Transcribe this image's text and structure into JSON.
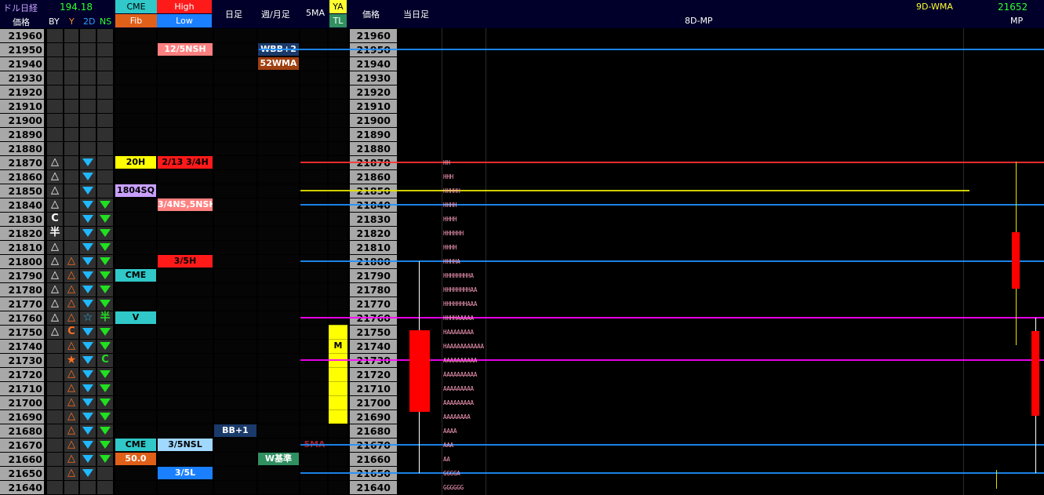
{
  "header": {
    "dollar_nikkei": "ドル日経",
    "dollar_value": "194.18",
    "price_label": "価格",
    "by": "BY",
    "y": "Y",
    "d2": "2D",
    "ns": "NS",
    "cme": "CME",
    "fib": "Fib",
    "high": "High",
    "low": "Low",
    "daily": "日足",
    "weekly_monthly": "週/月足",
    "ma5": "5MA",
    "ya": "YA",
    "tl": "TL",
    "price_label2": "価格",
    "today": "当日足",
    "mp8d": "8D-MP",
    "wma9d": "9D-WMA",
    "mp_value": "21652",
    "mp": "MP"
  },
  "prices": [
    "21960",
    "21950",
    "21940",
    "21930",
    "21920",
    "21910",
    "21900",
    "21890",
    "21880",
    "21870",
    "21860",
    "21850",
    "21840",
    "21830",
    "21820",
    "21810",
    "21800",
    "21790",
    "21780",
    "21770",
    "21760",
    "21750",
    "21740",
    "21730",
    "21720",
    "21710",
    "21700",
    "21690",
    "21680",
    "21670",
    "21660",
    "21650",
    "21640"
  ],
  "by_col": {
    "9": "△",
    "10": "△",
    "11": "△",
    "12": "△",
    "13": "C",
    "14": "半",
    "15": "△",
    "16": "△",
    "17": "△",
    "18": "△",
    "19": "△",
    "20": "△",
    "21": "△"
  },
  "y_col": {
    "16": "△",
    "17": "△",
    "18": "△",
    "19": "△",
    "20": "△",
    "21": "C",
    "22": "△",
    "24": "△",
    "25": "△",
    "26": "△",
    "27": "△",
    "28": "△",
    "29": "△",
    "30": "△",
    "31": "△"
  },
  "y_star_row": "23",
  "y_star": "★",
  "d2_star_row": "20",
  "d2_star": "☆",
  "ns_half": "半",
  "ns_c": "C",
  "cme_labels": [
    {
      "row": 9,
      "text": "20H"
    },
    {
      "row": 11,
      "text": "1804SQ"
    },
    {
      "row": 17,
      "text": "CME"
    },
    {
      "row": 20,
      "text": "V"
    },
    {
      "row": 29,
      "text": "CME"
    },
    {
      "row": 30,
      "text": "50.0"
    }
  ],
  "hl_labels": [
    {
      "row": 1,
      "text": "12/5NSH"
    },
    {
      "row": 9,
      "text": "2/13 3/4H"
    },
    {
      "row": 12,
      "text": "3/4NS,5NSH"
    },
    {
      "row": 16,
      "text": "3/5H"
    },
    {
      "row": 29,
      "text": "3/5NSL"
    },
    {
      "row": 31,
      "text": "3/5L"
    }
  ],
  "daily_labels": [
    {
      "row": 28,
      "text": "BB+1"
    }
  ],
  "weekly_labels": [
    {
      "row": 1,
      "text": "WBB+2"
    },
    {
      "row": 2,
      "text": "52WMA"
    },
    {
      "row": 30,
      "text": "W基準"
    }
  ],
  "ma5_label": "5MA",
  "ya_m": "M",
  "mp_profile": {
    "9": "HH",
    "10": "HHH",
    "11": "HHHHH",
    "12": "HHHH",
    "13": "HHHH",
    "14": "HHHHHH",
    "15": "HHHH",
    "16": "HHHHA",
    "17": "HHHHHHHHA",
    "18": "HHHHHHHHAA",
    "19": "HHHHHHHAAA",
    "20": "HHHHAAAAA",
    "21": "HAAAAAAAA",
    "22": "HAAAAAAAAAAA",
    "23": "AAAAAAAAAA",
    "24": "AAAAAAAAAA",
    "25": "AAAAAAAAA",
    "26": "AAAAAAAAA",
    "27": "AAAAAAAA",
    "28": "AAAA",
    "29": "AAA",
    "30": "AA",
    "31": "GGGGA",
    "32": "GGGGGG"
  },
  "colors": {
    "bg": "#000000",
    "price_bg": "#a0a0a0",
    "red_line": "#ff3030",
    "yellow_line": "#e6e600",
    "blue_line": "#1e90ff",
    "magenta_line": "#ff00ff",
    "candle": "#ff0000"
  }
}
